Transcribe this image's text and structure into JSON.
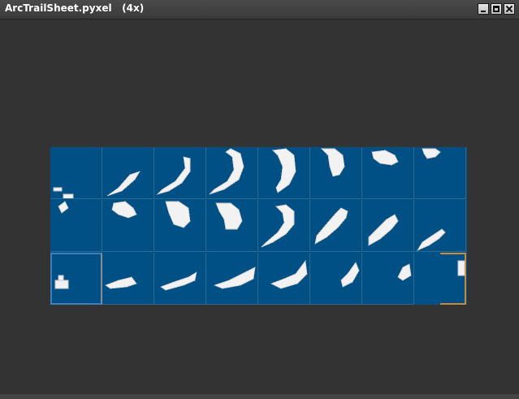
{
  "window": {
    "title": "ArcTrailSheet.pyxel   (4x)",
    "buttons": [
      "minimize",
      "maximize",
      "close"
    ]
  },
  "sheet": {
    "background": "#005086",
    "grid_line_color": "#2d6a90",
    "rows": 3,
    "cols": 8,
    "selected_primary_color": "#3f7fbf",
    "selected_secondary_color": "#c8893a"
  }
}
